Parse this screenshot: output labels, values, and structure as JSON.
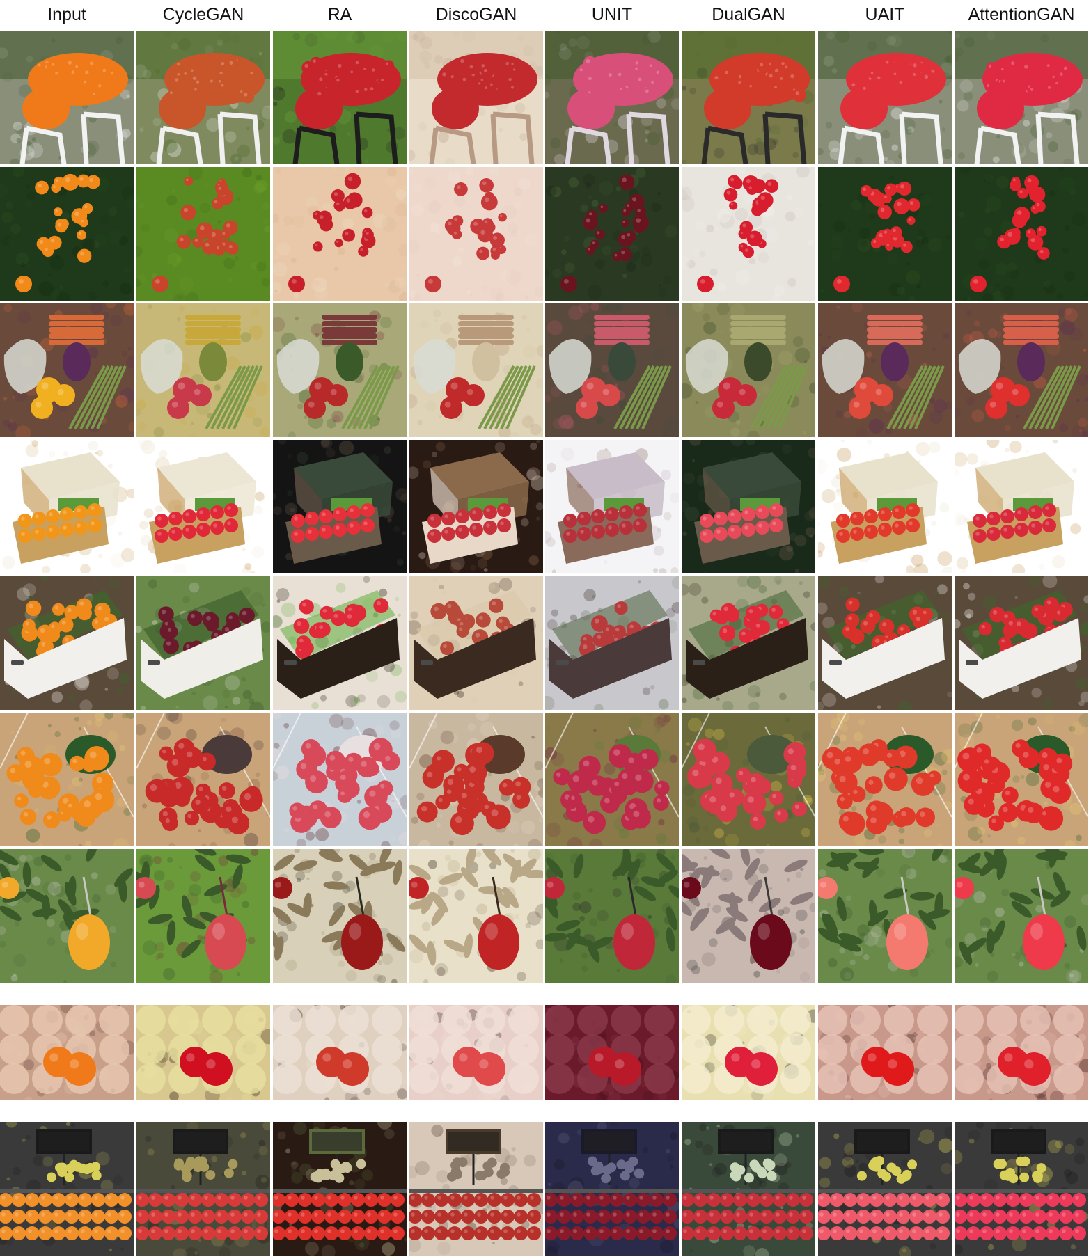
{
  "columns": [
    {
      "label": "Input"
    },
    {
      "label": "CycleGAN"
    },
    {
      "label": "RA"
    },
    {
      "label": "DiscoGAN"
    },
    {
      "label": "UNIT"
    },
    {
      "label": "DualGAN"
    },
    {
      "label": "UAIT"
    },
    {
      "label": "AttentionGAN"
    }
  ],
  "rows": [
    {
      "scene": "cafe-oranges",
      "tiles": [
        {
          "bg": "#8a8f7a",
          "fruit": "#f07a1a",
          "accent": "#f2f2f2",
          "detail": "#3f5a2c"
        },
        {
          "bg": "#7f8a5e",
          "fruit": "#c9562a",
          "accent": "#f0f0f0",
          "detail": "#4b6a2a"
        },
        {
          "bg": "#4f7a2e",
          "fruit": "#c8242c",
          "accent": "#1d1d1d",
          "detail": "#6a9a3a"
        },
        {
          "bg": "#e8dcc8",
          "fruit": "#c22a2e",
          "accent": "#b89a84",
          "detail": "#d4c0a8"
        },
        {
          "bg": "#6a6a4e",
          "fruit": "#d8507a",
          "accent": "#e0d8e0",
          "detail": "#3e5a2a"
        },
        {
          "bg": "#7a7a4a",
          "fruit": "#d23a2a",
          "accent": "#2a2a2a",
          "detail": "#4a6a2a"
        },
        {
          "bg": "#8a8f7a",
          "fruit": "#e0303a",
          "accent": "#f2f2f2",
          "detail": "#3f5a2c"
        },
        {
          "bg": "#8a8f7a",
          "fruit": "#e02a44",
          "accent": "#f2f2f2",
          "detail": "#3f5a2c"
        }
      ]
    },
    {
      "scene": "orange-tree",
      "tiles": [
        {
          "bg": "#1e3a1a",
          "fruit": "#f28a1a",
          "accent": "#2e4e22",
          "detail": "#15280f"
        },
        {
          "bg": "#5a8a22",
          "fruit": "#c8442a",
          "accent": "#6fa02a",
          "detail": "#3e6a1a"
        },
        {
          "bg": "#e8c8a8",
          "fruit": "#c8202a",
          "accent": "#d8b090",
          "detail": "#f0dcc4"
        },
        {
          "bg": "#eed8cc",
          "fruit": "#c83a3a",
          "accent": "#e4c8bc",
          "detail": "#f4e6dc"
        },
        {
          "bg": "#2a3a22",
          "fruit": "#6a1420",
          "accent": "#4a6a38",
          "detail": "#1a2418"
        },
        {
          "bg": "#e8e4de",
          "fruit": "#d81e2e",
          "accent": "#c8c0b8",
          "detail": "#f4f2ee"
        },
        {
          "bg": "#1e3a1a",
          "fruit": "#e0282e",
          "accent": "#2e4e22",
          "detail": "#15280f"
        },
        {
          "bg": "#1e3a1a",
          "fruit": "#e2222e",
          "accent": "#2e4e22",
          "detail": "#15280f"
        }
      ]
    },
    {
      "scene": "vegetables",
      "tiles": [
        {
          "bg": "#6a4a3a",
          "fruit": "#f0b020",
          "accent": "#d86a3a",
          "detail": "#5a2a5a"
        },
        {
          "bg": "#c8b878",
          "fruit": "#c83a4a",
          "accent": "#c8a83a",
          "detail": "#7a8a3a"
        },
        {
          "bg": "#a8a878",
          "fruit": "#b82a2a",
          "accent": "#7a3a3a",
          "detail": "#3a5a2a"
        },
        {
          "bg": "#e0d4b8",
          "fruit": "#c02a2a",
          "accent": "#b89a7a",
          "detail": "#d0c0a0"
        },
        {
          "bg": "#5a4a3e",
          "fruit": "#d84a4a",
          "accent": "#c85a6a",
          "detail": "#3a4a3a"
        },
        {
          "bg": "#8a8a5a",
          "fruit": "#c82a3a",
          "accent": "#a8a870",
          "detail": "#3a4a2a"
        },
        {
          "bg": "#6a4a3a",
          "fruit": "#e04a3a",
          "accent": "#d86a5a",
          "detail": "#5a2a5a"
        },
        {
          "bg": "#6a4a3a",
          "fruit": "#e0302e",
          "accent": "#d8604a",
          "detail": "#5a2a5a"
        }
      ]
    },
    {
      "scene": "box-oranges",
      "tiles": [
        {
          "bg": "#ffffff",
          "fruit": "#f2961a",
          "accent": "#e8e2cc",
          "detail": "#c8a060"
        },
        {
          "bg": "#ffffff",
          "fruit": "#e02838",
          "accent": "#ece6d4",
          "detail": "#c8a060"
        },
        {
          "bg": "#141414",
          "fruit": "#e8303a",
          "accent": "#3a4a3a",
          "detail": "#6a5a4a"
        },
        {
          "bg": "#2a1a14",
          "fruit": "#c8303a",
          "accent": "#8a6a4a",
          "detail": "#e8d8c8"
        },
        {
          "bg": "#f4f4f6",
          "fruit": "#b8303a",
          "accent": "#c8bcc8",
          "detail": "#8a6a5a"
        },
        {
          "bg": "#1a2a1a",
          "fruit": "#e84a5a",
          "accent": "#3a4a3a",
          "detail": "#6a5a4a"
        },
        {
          "bg": "#ffffff",
          "fruit": "#e23a2a",
          "accent": "#e8e2cc",
          "detail": "#c8a060"
        },
        {
          "bg": "#ffffff",
          "fruit": "#d82a3a",
          "accent": "#e8e2cc",
          "detail": "#c8a060"
        }
      ]
    },
    {
      "scene": "crate-oranges",
      "tiles": [
        {
          "bg": "#5a4a3a",
          "fruit": "#f08a1a",
          "accent": "#f2f0ec",
          "detail": "#3a6a2a"
        },
        {
          "bg": "#6a8a4a",
          "fruit": "#6a1a2a",
          "accent": "#f0eee8",
          "detail": "#3a5a2a"
        },
        {
          "bg": "#e8e0d4",
          "fruit": "#e02a3a",
          "accent": "#2a2018",
          "detail": "#6ab04a"
        },
        {
          "bg": "#e0d0b8",
          "fruit": "#b84a3a",
          "accent": "#3a2a20",
          "detail": "#d8c8a8"
        },
        {
          "bg": "#c8c8cc",
          "fruit": "#b83a3a",
          "accent": "#4a3a3a",
          "detail": "#5a6a4a"
        },
        {
          "bg": "#a8a88a",
          "fruit": "#e02a3a",
          "accent": "#2a2018",
          "detail": "#4a6a3a"
        },
        {
          "bg": "#5a4a3a",
          "fruit": "#d8302a",
          "accent": "#f2f0ec",
          "detail": "#3a6a2a"
        },
        {
          "bg": "#5a4a3a",
          "fruit": "#d82a30",
          "accent": "#f2f0ec",
          "detail": "#3a6a2a"
        }
      ]
    },
    {
      "scene": "table-produce",
      "tiles": [
        {
          "bg": "#c8a478",
          "fruit": "#f08a1a",
          "accent": "#e8c870",
          "detail": "#2a5a2a"
        },
        {
          "bg": "#c8a478",
          "fruit": "#c82a2a",
          "accent": "#8a5a4a",
          "detail": "#4a3a3a"
        },
        {
          "bg": "#c8d0d8",
          "fruit": "#d84a5a",
          "accent": "#5a2a2a",
          "detail": "#e8e0e0"
        },
        {
          "bg": "#c8b8a0",
          "fruit": "#c8302a",
          "accent": "#e8d8c8",
          "detail": "#5a3a2a"
        },
        {
          "bg": "#8a7a4a",
          "fruit": "#c02a4a",
          "accent": "#6a1a3a",
          "detail": "#5a7a3a"
        },
        {
          "bg": "#6a6a3a",
          "fruit": "#d83a4a",
          "accent": "#e8c84a",
          "detail": "#4a5a3a"
        },
        {
          "bg": "#c8a478",
          "fruit": "#e03a2a",
          "accent": "#e8c870",
          "detail": "#2a5a2a"
        },
        {
          "bg": "#c8a478",
          "fruit": "#e02a2a",
          "accent": "#e8c870",
          "detail": "#2a5a2a"
        }
      ]
    },
    {
      "scene": "orange-branch",
      "tiles": [
        {
          "bg": "#6a8a4a",
          "fruit": "#f2a828",
          "accent": "#3a5a2a",
          "detail": "#c8c8c0"
        },
        {
          "bg": "#6a9a3a",
          "fruit": "#d84a52",
          "accent": "#3a5a2a",
          "detail": "#7a2a3a"
        },
        {
          "bg": "#d8d0b8",
          "fruit": "#9a1a1a",
          "accent": "#8a7a5a",
          "detail": "#2a2a20"
        },
        {
          "bg": "#e8e0c8",
          "fruit": "#c02424",
          "accent": "#b8a888",
          "detail": "#3a2a20"
        },
        {
          "bg": "#5a7a3a",
          "fruit": "#c0283a",
          "accent": "#3a5a2a",
          "detail": "#2a2a2a"
        },
        {
          "bg": "#c8b8b0",
          "fruit": "#6a0a1a",
          "accent": "#8a7a7a",
          "detail": "#3a3a3a"
        },
        {
          "bg": "#6a8a4a",
          "fruit": "#f47a70",
          "accent": "#3a5a2a",
          "detail": "#c8c8c0"
        },
        {
          "bg": "#6a8a4a",
          "fruit": "#ee3a4a",
          "accent": "#3a5a2a",
          "detail": "#c8c8c0"
        }
      ]
    },
    {
      "scene": "orange-tray",
      "tiles": [
        {
          "bg": "#c8a08a",
          "fruit": "#f07a1a",
          "accent": "#e8c8b0",
          "detail": "#3a1a1a"
        },
        {
          "bg": "#d8c890",
          "fruit": "#d01020",
          "accent": "#e8e0a0",
          "detail": "#2a1a10"
        },
        {
          "bg": "#e0d0c0",
          "fruit": "#d03a2a",
          "accent": "#ece0d4",
          "detail": "#1a0a0a"
        },
        {
          "bg": "#e8d0c8",
          "fruit": "#e04a4a",
          "accent": "#f0e0d8",
          "detail": "#2a1a10"
        },
        {
          "bg": "#6a1a2a",
          "fruit": "#b81a2a",
          "accent": "#8a3a4a",
          "detail": "#3a0a14"
        },
        {
          "bg": "#e8e0b0",
          "fruit": "#e0203a",
          "accent": "#f4ecd0",
          "detail": "#1a1a1a"
        },
        {
          "bg": "#c8988a",
          "fruit": "#e01a1a",
          "accent": "#e8c4b8",
          "detail": "#3a1a1a"
        },
        {
          "bg": "#c8988a",
          "fruit": "#e0202a",
          "accent": "#e8c4b8",
          "detail": "#3a1a1a"
        }
      ]
    },
    {
      "scene": "market-stall",
      "tiles": [
        {
          "bg": "#3a3a3a",
          "fruit": "#f2902a",
          "accent": "#d8d058",
          "detail": "#1a1a1a"
        },
        {
          "bg": "#4a4a3a",
          "fruit": "#d83a3a",
          "accent": "#a89a5a",
          "detail": "#1a1a1a"
        },
        {
          "bg": "#2a1a14",
          "fruit": "#e0302a",
          "accent": "#c8c098",
          "detail": "#5a6a3a"
        },
        {
          "bg": "#d8c8b8",
          "fruit": "#b8302a",
          "accent": "#8a7a6a",
          "detail": "#4a3a2a"
        },
        {
          "bg": "#2a2a4a",
          "fruit": "#8a1a2a",
          "accent": "#6a6a8a",
          "detail": "#1a1a2a"
        },
        {
          "bg": "#3a4a3a",
          "fruit": "#c8303a",
          "accent": "#c8d8b8",
          "detail": "#1a1a1a"
        },
        {
          "bg": "#3a3a3a",
          "fruit": "#ee5a6a",
          "accent": "#d8d058",
          "detail": "#1a1a1a"
        },
        {
          "bg": "#3a3a3a",
          "fruit": "#ee3a5a",
          "accent": "#d8d058",
          "detail": "#1a1a1a"
        }
      ]
    }
  ]
}
